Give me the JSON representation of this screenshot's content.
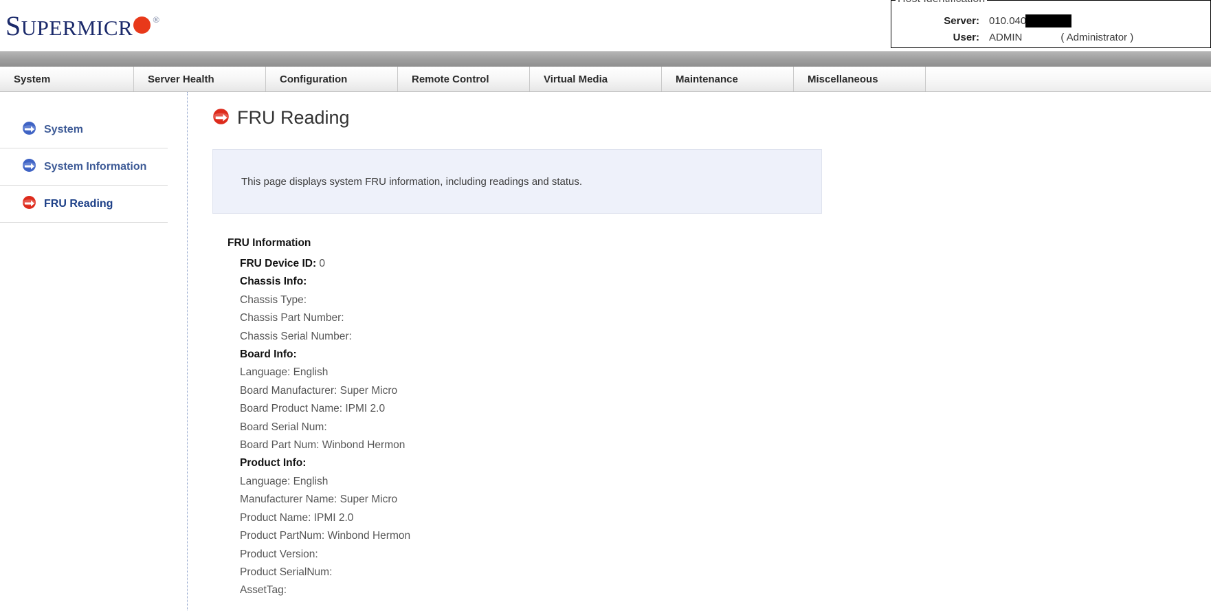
{
  "brand": {
    "name_part1": "S",
    "name_part2": "UPERMICR",
    "trademark": "®",
    "logo_navy": "#1b2a6b",
    "logo_red": "#e8391a"
  },
  "host_identification": {
    "legend": "Host Identification",
    "server_label": "Server:",
    "server_value": "010.040",
    "server_redacted": true,
    "user_label": "User:",
    "user_value": "ADMIN",
    "user_role": "( Administrator )"
  },
  "nav": {
    "tabs": [
      {
        "label": "System"
      },
      {
        "label": "Server Health"
      },
      {
        "label": "Configuration"
      },
      {
        "label": "Remote Control"
      },
      {
        "label": "Virtual Media"
      },
      {
        "label": "Maintenance"
      },
      {
        "label": "Miscellaneous"
      }
    ]
  },
  "sidebar": {
    "items": [
      {
        "label": "System",
        "icon": "blue-circle-arrow-icon",
        "active": false
      },
      {
        "label": "System Information",
        "icon": "blue-circle-arrow-icon",
        "active": false
      },
      {
        "label": "FRU Reading",
        "icon": "red-circle-arrow-icon",
        "active": true
      }
    ]
  },
  "page": {
    "title": "FRU Reading",
    "title_icon": "red-circle-arrow-icon",
    "info_text": "This page displays system FRU information, including readings and status."
  },
  "fru": {
    "heading": "FRU Information",
    "rows": [
      {
        "label": "FRU Device ID:",
        "value": "0",
        "style": "label-bold"
      },
      {
        "label": "Chassis Info:",
        "value": "",
        "style": "section"
      },
      {
        "label": "Chassis Type:",
        "value": "",
        "style": "normal"
      },
      {
        "label": "Chassis Part Number:",
        "value": "",
        "style": "normal"
      },
      {
        "label": "Chassis Serial Number:",
        "value": "",
        "style": "normal"
      },
      {
        "label": "Board Info:",
        "value": "",
        "style": "section"
      },
      {
        "label": "Language:",
        "value": "English",
        "style": "normal"
      },
      {
        "label": "Board Manufacturer:",
        "value": "Super Micro",
        "style": "normal"
      },
      {
        "label": "Board Product Name:",
        "value": "IPMI 2.0",
        "style": "normal"
      },
      {
        "label": "Board Serial Num:",
        "value": "",
        "style": "normal"
      },
      {
        "label": "Board Part Num:",
        "value": "Winbond Hermon",
        "style": "normal"
      },
      {
        "label": "Product Info:",
        "value": "",
        "style": "section"
      },
      {
        "label": "Language:",
        "value": "English",
        "style": "normal"
      },
      {
        "label": "Manufacturer Name:",
        "value": "Super Micro",
        "style": "normal"
      },
      {
        "label": "Product Name:",
        "value": "IPMI 2.0",
        "style": "normal"
      },
      {
        "label": "Product PartNum:",
        "value": "Winbond Hermon",
        "style": "normal"
      },
      {
        "label": "Product Version:",
        "value": "",
        "style": "normal"
      },
      {
        "label": "Product SerialNum:",
        "value": "",
        "style": "normal"
      },
      {
        "label": "AssetTag:",
        "value": "",
        "style": "normal"
      }
    ]
  }
}
